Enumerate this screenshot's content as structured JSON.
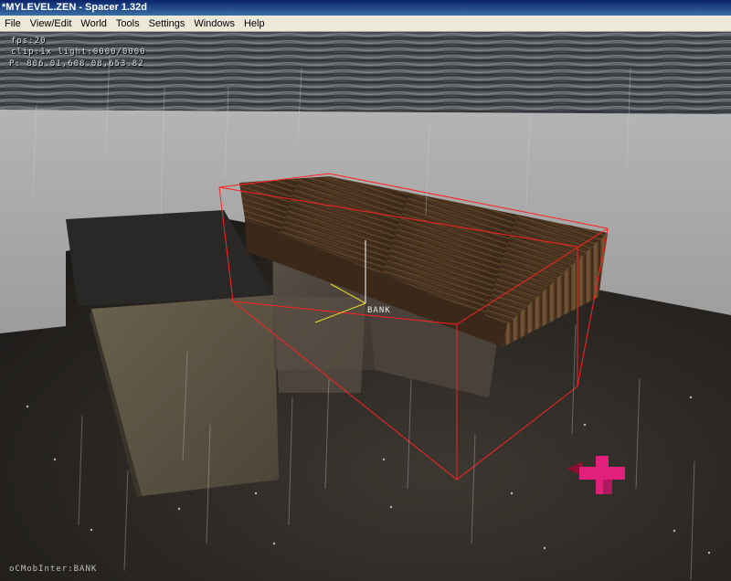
{
  "window": {
    "title": "*MYLEVEL.ZEN - Spacer 1.32d"
  },
  "menu": {
    "items": [
      "File",
      "View/Edit",
      "World",
      "Tools",
      "Settings",
      "Windows",
      "Help"
    ]
  },
  "hud": {
    "fps": "fps:20",
    "clip": "clip:1x   light:0000/0000",
    "position": "P: 806.01,608.08,653.82"
  },
  "viewport": {
    "selected_vob_label": "BANK",
    "status": "oCMobInter:BANK"
  },
  "colors": {
    "selection_box": "#ff2020",
    "gizmo_axis": "#e8e020",
    "gizmo_up": "#ffffff",
    "camera_marker": "#e0207a"
  }
}
